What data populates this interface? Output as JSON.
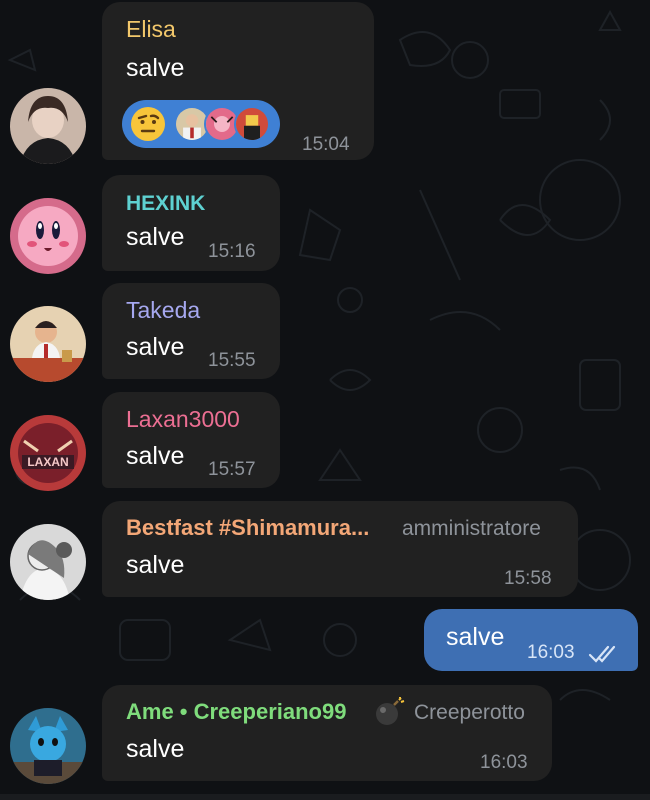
{
  "colors": {
    "background": "#0f1114",
    "incoming_bubble": "#212121",
    "outgoing_bubble": "#3e6fb3",
    "reaction_pill": "#3f80d4",
    "timestamp": "#8e939a"
  },
  "messages": [
    {
      "sender": "Elisa",
      "sender_color": "#f3c86b",
      "text": "salve",
      "time": "15:04",
      "reaction_emoji": "raised-eyebrow-face"
    },
    {
      "sender": "HEXINK",
      "sender_color": "#5ed1d1",
      "text": "salve",
      "time": "15:16"
    },
    {
      "sender": "Takeda",
      "sender_color": "#a6a8ef",
      "text": "salve",
      "time": "15:55"
    },
    {
      "sender": "Laxan3000",
      "sender_color": "#ec6f93",
      "text": "salve",
      "time": "15:57"
    },
    {
      "sender": "Bestfast #Shimamura...",
      "sender_color": "#f3a777",
      "role": "amministratore",
      "text": "salve",
      "time": "15:58"
    },
    {
      "sender": "Ame • Creeperiano99",
      "sender_color": "#7fdc7c",
      "role": "Creeperotto",
      "status_emoji": "bomb-icon",
      "text": "salve",
      "time": "16:03"
    }
  ],
  "outgoing": {
    "text": "salve",
    "time": "16:03",
    "status": "read-double-check"
  }
}
